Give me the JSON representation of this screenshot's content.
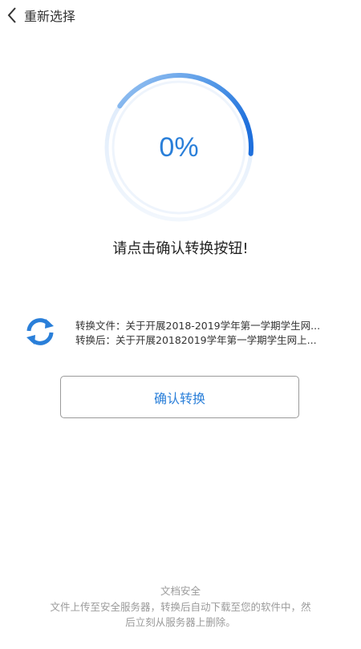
{
  "header": {
    "back_label": "重新选择"
  },
  "progress": {
    "value": 0.9,
    "text": "0%"
  },
  "prompt": "请点击确认转换按钮!",
  "file": {
    "source_line": "转换文件：关于开展2018-2019学年第一学期学生网...",
    "target_line": "转换后：关于开展20182019学年第一学期学生网上..."
  },
  "confirm_label": "确认转换",
  "footer": {
    "title": "文档安全",
    "description": "文件上传至安全服务器，转换后自动下载至您的软件中，然后立刻从服务器上删除。"
  },
  "colors": {
    "accent": "#2a7fd9",
    "ring_track": "#e6f0fb",
    "muted_text": "#9a9a9a"
  },
  "icons": {
    "back": "chevron-left-icon",
    "convert": "refresh-icon"
  }
}
